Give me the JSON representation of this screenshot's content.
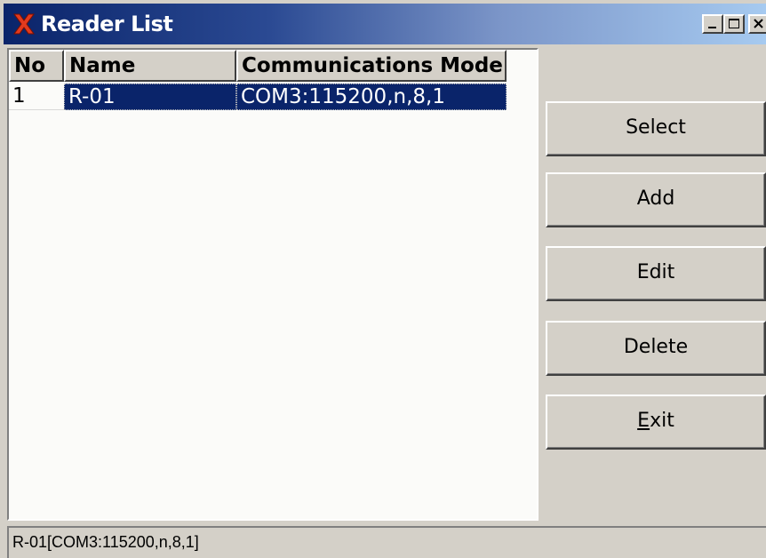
{
  "window": {
    "title": "Reader List",
    "accent_color": "#0a246a",
    "icon": "x-app-icon"
  },
  "titlebar_buttons": {
    "minimize": "minimize-icon",
    "maximize": "maximize-icon",
    "close": "close-icon"
  },
  "list": {
    "columns": [
      "No",
      "Name",
      "Communications Mode"
    ],
    "rows": [
      {
        "no": "1",
        "name": "R-01",
        "mode": "COM3:115200,n,8,1",
        "selected": true
      }
    ]
  },
  "buttons": {
    "select": "Select",
    "add": "Add",
    "edit": "Edit",
    "delete": "Delete",
    "exit_prefix": "E",
    "exit_rest": "xit"
  },
  "status": {
    "text": "R-01[COM3:115200,n,8,1]"
  }
}
